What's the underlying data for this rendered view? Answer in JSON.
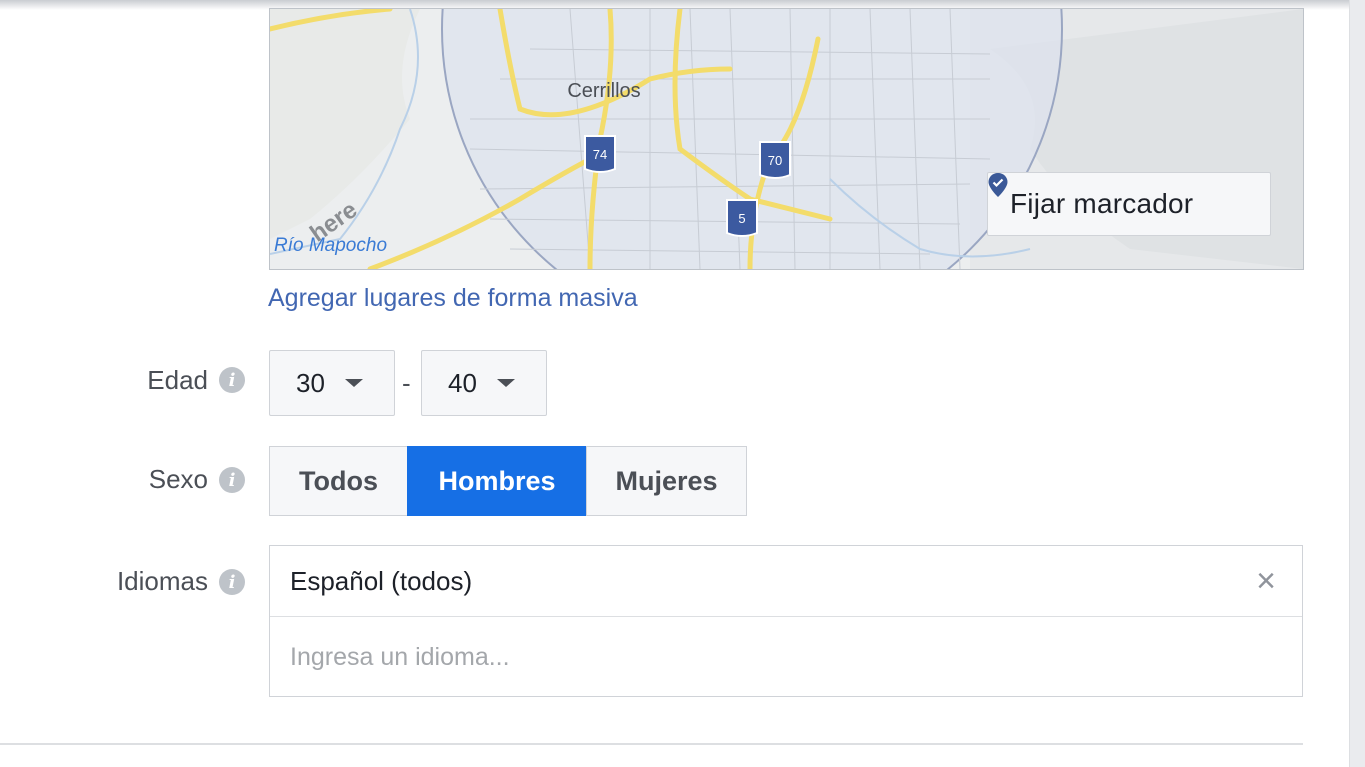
{
  "map": {
    "city_label": "Cerrillos",
    "river_label": "Río Mapocho",
    "watermark": "here",
    "shields": [
      "74",
      "70",
      "5"
    ],
    "pin_button_label": "Fijar marcador"
  },
  "bulk_link": "Agregar lugares de forma masiva",
  "age": {
    "label": "Edad",
    "min": "30",
    "separator": "-",
    "max": "40"
  },
  "gender": {
    "label": "Sexo",
    "options": [
      "Todos",
      "Hombres",
      "Mujeres"
    ],
    "selected": "Hombres"
  },
  "languages": {
    "label": "Idiomas",
    "selected": "Español (todos)",
    "placeholder": "Ingresa un idioma..."
  },
  "info_icon_glyph": "i",
  "colors": {
    "link": "#4267b2",
    "active": "#166fe5",
    "road": "#f3dc6b"
  }
}
